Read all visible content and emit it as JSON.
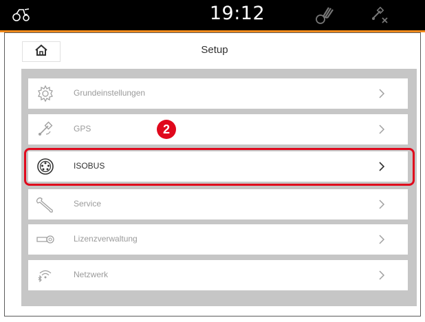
{
  "status_bar": {
    "time": "19:12",
    "left_icon": "tractor-icon",
    "implement_icon": "implement-icon",
    "gps_icon": "gps-off-icon"
  },
  "header": {
    "title": "Setup",
    "home_icon": "home-icon"
  },
  "menu": {
    "items": [
      {
        "label": "Grundeinstellungen",
        "icon": "gear-icon",
        "active": false
      },
      {
        "label": "GPS",
        "icon": "gps-icon",
        "active": false
      },
      {
        "label": "ISOBUS",
        "icon": "isobus-connector-icon",
        "active": true
      },
      {
        "label": "Service",
        "icon": "wrench-icon",
        "active": false
      },
      {
        "label": "Lizenzverwaltung",
        "icon": "key-icon",
        "active": false
      },
      {
        "label": "Netzwerk",
        "icon": "network-icon",
        "active": false
      }
    ]
  },
  "callout": {
    "number": "2"
  },
  "colors": {
    "accent": "#f08a1c",
    "highlight": "#e0081c",
    "list_background": "#c6c6c6"
  }
}
